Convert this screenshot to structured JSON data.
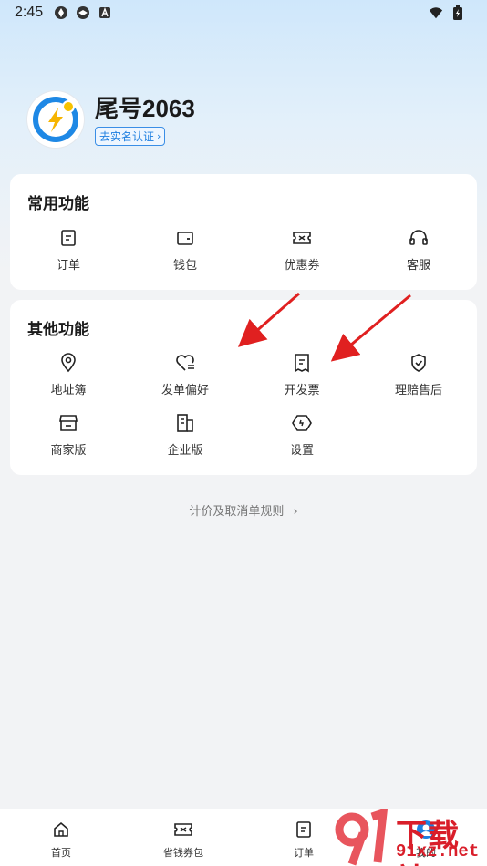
{
  "status_bar": {
    "time": "2:45"
  },
  "profile": {
    "name": "尾号2063",
    "verify_label": "去实名认证"
  },
  "common_functions": {
    "title": "常用功能",
    "items": [
      {
        "label": "订单",
        "icon": "order-icon"
      },
      {
        "label": "钱包",
        "icon": "wallet-icon"
      },
      {
        "label": "优惠券",
        "icon": "coupon-icon"
      },
      {
        "label": "客服",
        "icon": "headset-icon"
      }
    ]
  },
  "other_functions": {
    "title": "其他功能",
    "items": [
      {
        "label": "地址簿",
        "icon": "location-pin-icon"
      },
      {
        "label": "发单偏好",
        "icon": "heart-list-icon"
      },
      {
        "label": "开发票",
        "icon": "invoice-icon"
      },
      {
        "label": "理赔售后",
        "icon": "shield-check-icon"
      },
      {
        "label": "商家版",
        "icon": "store-icon"
      },
      {
        "label": "企业版",
        "icon": "building-icon"
      },
      {
        "label": "设置",
        "icon": "settings-hexagon-icon"
      }
    ]
  },
  "rules_link": "计价及取消单规则",
  "bottom_nav": [
    {
      "label": "首页",
      "icon": "home-icon"
    },
    {
      "label": "省钱券包",
      "icon": "coupon-icon"
    },
    {
      "label": "订单",
      "icon": "order-icon"
    },
    {
      "label": "我的",
      "icon": "profile-icon"
    }
  ],
  "watermark": {
    "top": "下载站",
    "bottom": "91xz.net"
  },
  "colors": {
    "accent_blue": "#1e7fe0",
    "arrow_red": "#e02020",
    "watermark_red": "#d91e2a"
  }
}
